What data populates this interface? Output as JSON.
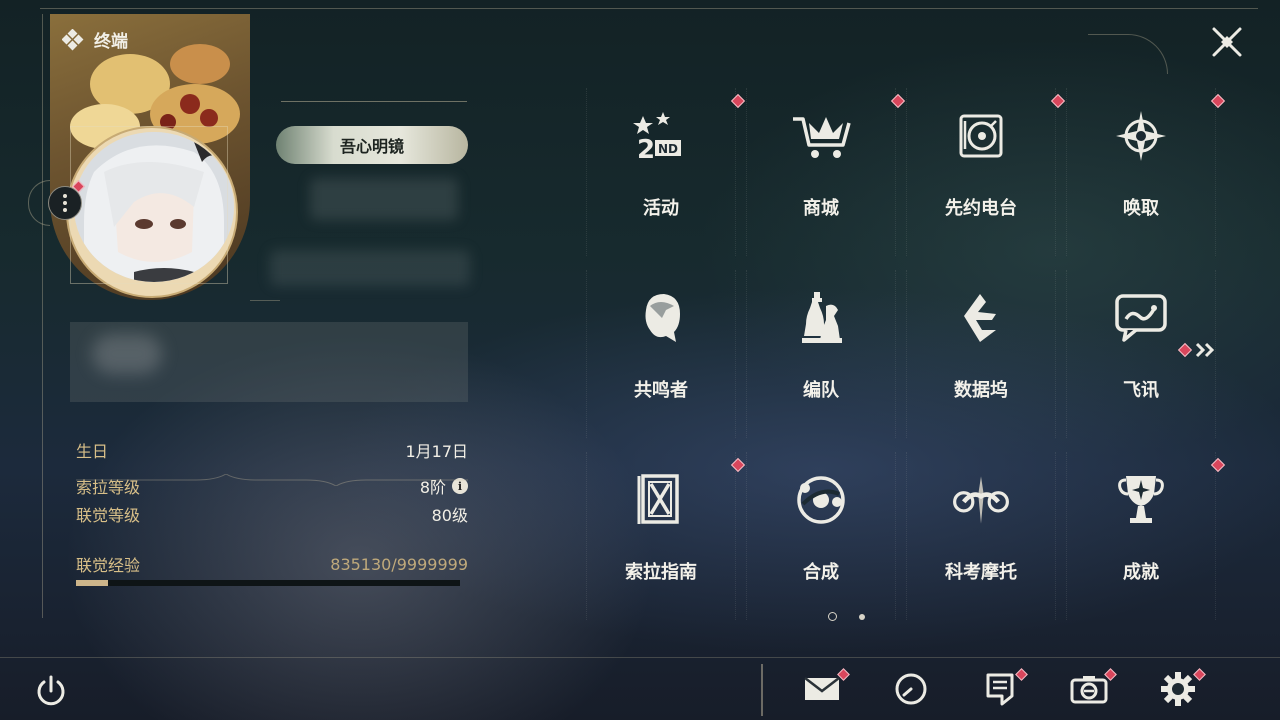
{
  "window": {
    "title": "终端"
  },
  "profile": {
    "title_name": "吾心明镜",
    "birthday_label": "生日",
    "birthday_value": "1月17日",
    "sola_level_label": "索拉等级",
    "sola_level_value": "8阶",
    "union_level_label": "联觉等级",
    "union_level_value": "80级",
    "union_exp_label": "联觉经验",
    "union_exp_value": "835130/9999999",
    "union_exp_progress": 0.0835
  },
  "menu": {
    "items": [
      {
        "label": "活动",
        "icon": "event-2nd-anniversary-icon",
        "badge": true
      },
      {
        "label": "商城",
        "icon": "shop-crown-cart-icon",
        "badge": true
      },
      {
        "label": "先约电台",
        "icon": "radio-record-player-icon",
        "badge": true
      },
      {
        "label": "唤取",
        "icon": "convene-star-compass-icon",
        "badge": true
      },
      {
        "label": "共鸣者",
        "icon": "resonator-head-icon",
        "badge": false
      },
      {
        "label": "编队",
        "icon": "team-chess-pieces-icon",
        "badge": false
      },
      {
        "label": "数据坞",
        "icon": "data-bank-icon",
        "badge": false
      },
      {
        "label": "飞讯",
        "icon": "chat-bubble-icon",
        "badge": false
      },
      {
        "label": "索拉指南",
        "icon": "guidebook-icon",
        "badge": true
      },
      {
        "label": "合成",
        "icon": "synthesis-orbit-icon",
        "badge": false
      },
      {
        "label": "科考摩托",
        "icon": "motorcycle-icon",
        "badge": false
      },
      {
        "label": "成就",
        "icon": "achievement-trophy-icon",
        "badge": true
      }
    ],
    "page_count": 2,
    "current_page": 1
  },
  "bottom_bar": {
    "icons": [
      "mail-icon",
      "clock-icon",
      "notice-icon",
      "camera-icon",
      "settings-gear-icon"
    ]
  },
  "colors": {
    "accent_gold": "#d8bf88",
    "badge_red": "#d9465c",
    "text_light": "#f3f1ea"
  }
}
